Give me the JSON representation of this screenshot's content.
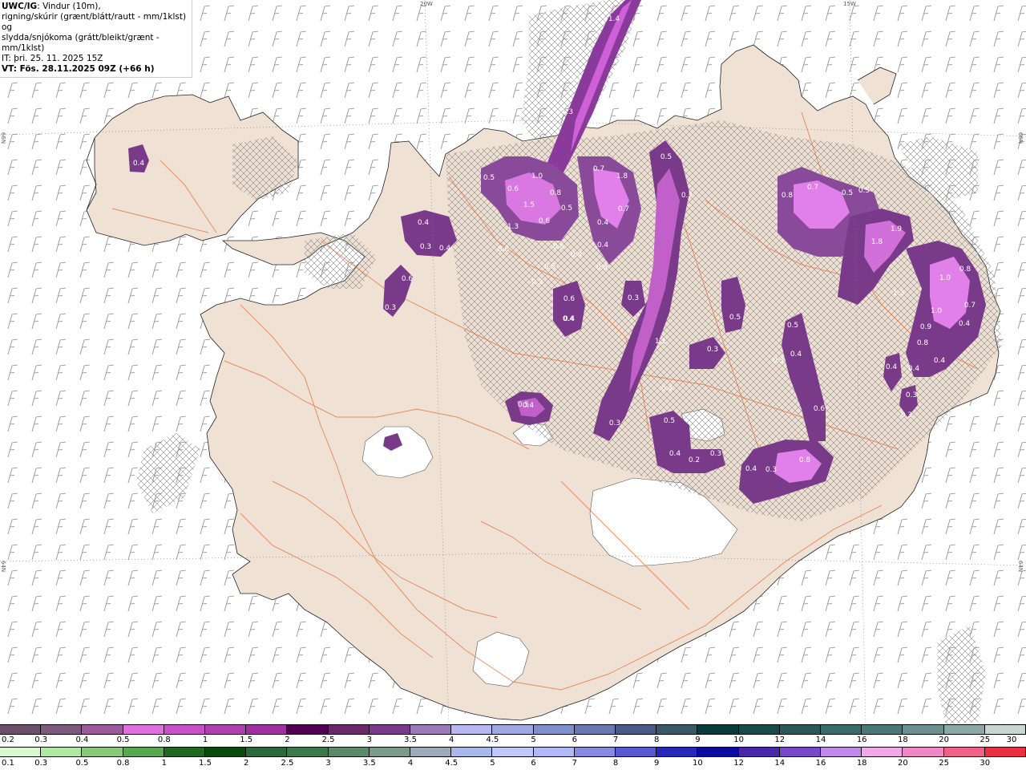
{
  "header": {
    "title_bold": "UWC/IG",
    "title_rest": ": Vindur (10m),",
    "line2": "rigning/skúrir (grænt/blátt/rautt - mm/1klst) og",
    "line3": "slydda/snjókoma (grátt/bleikt/grænt - mm/1klst)",
    "line4": "IT: þri. 25. 11. 2025 15Z",
    "line5": "VT: Fös. 28.11.2025 09Z (+66 h)"
  },
  "graticule": {
    "lon_top": [
      "20W",
      "15W"
    ],
    "lat_left": [
      "66N",
      "64N"
    ],
    "lat_right": [
      "66N",
      "64N"
    ]
  },
  "precip_values": [
    "0.4",
    "0.4",
    "0.3",
    "0.4",
    "0.6",
    "0.3",
    "0.6",
    "0.5",
    "0.6",
    "1.0",
    "0.8",
    "0.5",
    "1.5",
    "1.3",
    "0.6",
    "0.6",
    "0.5",
    "0.4",
    "0.6",
    "0.3",
    "0.4",
    "0.7",
    "1.8",
    "0.7",
    "0.4",
    "0.8",
    "0.4",
    "0.3",
    "0.5",
    "0.7",
    "1.1",
    "0.4",
    "0.5",
    "0.4",
    "0.2",
    "0.3",
    "0.3",
    "0.5",
    "0.4",
    "0.3",
    "0.8",
    "0.7",
    "0.5",
    "0.5",
    "1.9",
    "1.8",
    "1.3",
    "1.0",
    "0.8",
    "0.7",
    "1.0",
    "0.9",
    "0.8",
    "0.4",
    "0.4",
    "0.4",
    "0.3",
    "0.3",
    "0.5",
    "0.4",
    "0.3",
    "0.6",
    "0.4",
    "0.4",
    "0.8",
    "0.3",
    "0.5",
    "1.7",
    "1.3",
    "1.4",
    "0.4"
  ],
  "colorbar_snow": {
    "labels": [
      "0.2",
      "0.3",
      "0.4",
      "0.5",
      "0.8",
      "1",
      "1.5",
      "2",
      "2.5",
      "3",
      "3.5",
      "4",
      "4.5",
      "5",
      "6",
      "7",
      "8",
      "9",
      "10",
      "12",
      "14",
      "16",
      "18",
      "20",
      "25",
      "30"
    ],
    "colors": [
      "#6b4f6b",
      "#7d5a7d",
      "#9a5a9a",
      "#e070e0",
      "#c850c8",
      "#b040b0",
      "#a030a0",
      "#500050",
      "#6a2a6a",
      "#7a3a8a",
      "#9a7ab8",
      "#b8b8f0",
      "#a0a8e0",
      "#8090c8",
      "#6a78b0",
      "#4a5a88",
      "#3a5868",
      "#0a3a3a",
      "#184a4a",
      "#2a5858",
      "#3a6a6a",
      "#4a7878",
      "#6a9090",
      "#8aa8a8",
      "#c8d8d0"
    ]
  },
  "colorbar_rain": {
    "labels": [
      "0.1",
      "0.3",
      "0.5",
      "0.8",
      "1",
      "1.5",
      "2",
      "2.5",
      "3",
      "3.5",
      "4",
      "4.5",
      "5",
      "6",
      "7",
      "8",
      "9",
      "10",
      "12",
      "14",
      "16",
      "18",
      "20",
      "25",
      "30"
    ],
    "colors": [
      "#d8f8d0",
      "#b0e8a0",
      "#88c878",
      "#58a850",
      "#206820",
      "#0a4a0a",
      "#2a6a3a",
      "#3a7a4a",
      "#5a8a6a",
      "#7a9a8a",
      "#9aaab8",
      "#a8b8e8",
      "#c0c8f8",
      "#b0b8f8",
      "#8888e0",
      "#5858d0",
      "#2828b8",
      "#0a0aa0",
      "#4828a8",
      "#7848c8",
      "#c088e8",
      "#f0a8e8",
      "#f088c8",
      "#f06088",
      "#e83040"
    ]
  },
  "colors": {
    "land": "#efe1d3",
    "sea": "#ffffff",
    "road": "#e8703a",
    "barb": "#7a7a7a"
  }
}
